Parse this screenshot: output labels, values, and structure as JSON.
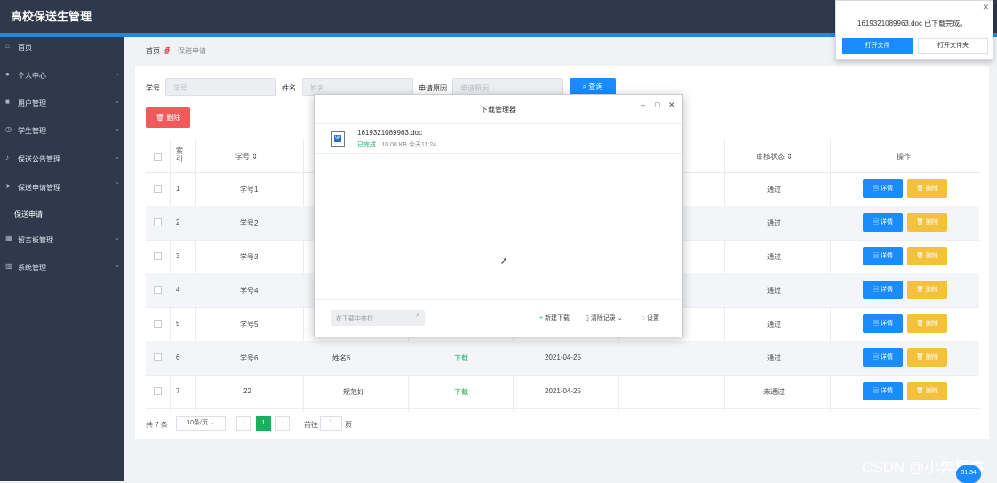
{
  "app": {
    "title": "高校保送生管理"
  },
  "sidebar": {
    "items": [
      {
        "label": "首页",
        "icon": "home-icon",
        "chevron": false
      },
      {
        "label": "个人中心",
        "icon": "user-icon",
        "chevron": true
      },
      {
        "label": "用户管理",
        "icon": "users-icon",
        "chevron": true
      },
      {
        "label": "学生管理",
        "icon": "clock-icon",
        "chevron": true
      },
      {
        "label": "保送公告管理",
        "icon": "bell-icon",
        "chevron": true
      },
      {
        "label": "保送申请管理",
        "icon": "send-icon",
        "chevron": true
      },
      {
        "label": "留言板管理",
        "icon": "grid-icon",
        "chevron": true
      },
      {
        "label": "系统管理",
        "icon": "chart-icon",
        "chevron": true
      }
    ],
    "subitem": "保送申请"
  },
  "breadcrumb": {
    "home": "首页",
    "current": "保送申请"
  },
  "filters": {
    "student_id_label": "学号",
    "student_id_placeholder": "学号",
    "name_label": "姓名",
    "name_placeholder": "姓名",
    "reason_label": "申请原因",
    "reason_placeholder": "申请原因",
    "query_label": "查询",
    "delete_label": "删除"
  },
  "table": {
    "headers": {
      "index": "索引",
      "student_id": "学号",
      "status": "审核状态",
      "actions": "操作"
    },
    "rows": [
      {
        "index": "1",
        "student_id": "学号1",
        "name": "",
        "file": "",
        "date": "",
        "status": "通过"
      },
      {
        "index": "2",
        "student_id": "学号2",
        "name": "",
        "file": "",
        "date": "",
        "status": "通过"
      },
      {
        "index": "3",
        "student_id": "学号3",
        "name": "",
        "file": "",
        "date": "",
        "status": "通过"
      },
      {
        "index": "4",
        "student_id": "学号4",
        "name": "",
        "file": "",
        "date": "",
        "status": "通过"
      },
      {
        "index": "5",
        "student_id": "学号5",
        "name": "",
        "file": "",
        "date": "",
        "status": "通过"
      },
      {
        "index": "6",
        "student_id": "学号6",
        "name": "姓名6",
        "file": "下载",
        "date": "2021-04-25",
        "status": "通过"
      },
      {
        "index": "7",
        "student_id": "22",
        "name": "规范好",
        "file": "下载",
        "date": "2021-04-25",
        "status": "未通过"
      }
    ],
    "detail_label": "详情",
    "delete_label": "删除"
  },
  "pagination": {
    "total": "共 7 条",
    "page_size": "10条/页",
    "current_page": "1",
    "goto_label": "前往",
    "goto_value": "1",
    "page_suffix": "页"
  },
  "download_manager": {
    "title": "下载管理器",
    "file_name": "1619321089963.doc",
    "file_status": "已完成",
    "file_size": "10.00 KB",
    "file_time": "今天11:24",
    "search_placeholder": "在下载中查找",
    "new_download": "新建下载",
    "clear_records": "清除记录",
    "settings": "设置"
  },
  "notification": {
    "text": "1619321089963.doc 已下载完成。",
    "open_file": "打开文件",
    "open_folder": "打开文件夹"
  },
  "watermark": "CSDN @小奔程序",
  "clock": "01:34",
  "colors": {
    "sidebar": "#2e3a4c",
    "primary": "#1a8cff",
    "danger": "#f05a5a",
    "warning": "#f3c13a",
    "success": "#1aaf5d"
  }
}
